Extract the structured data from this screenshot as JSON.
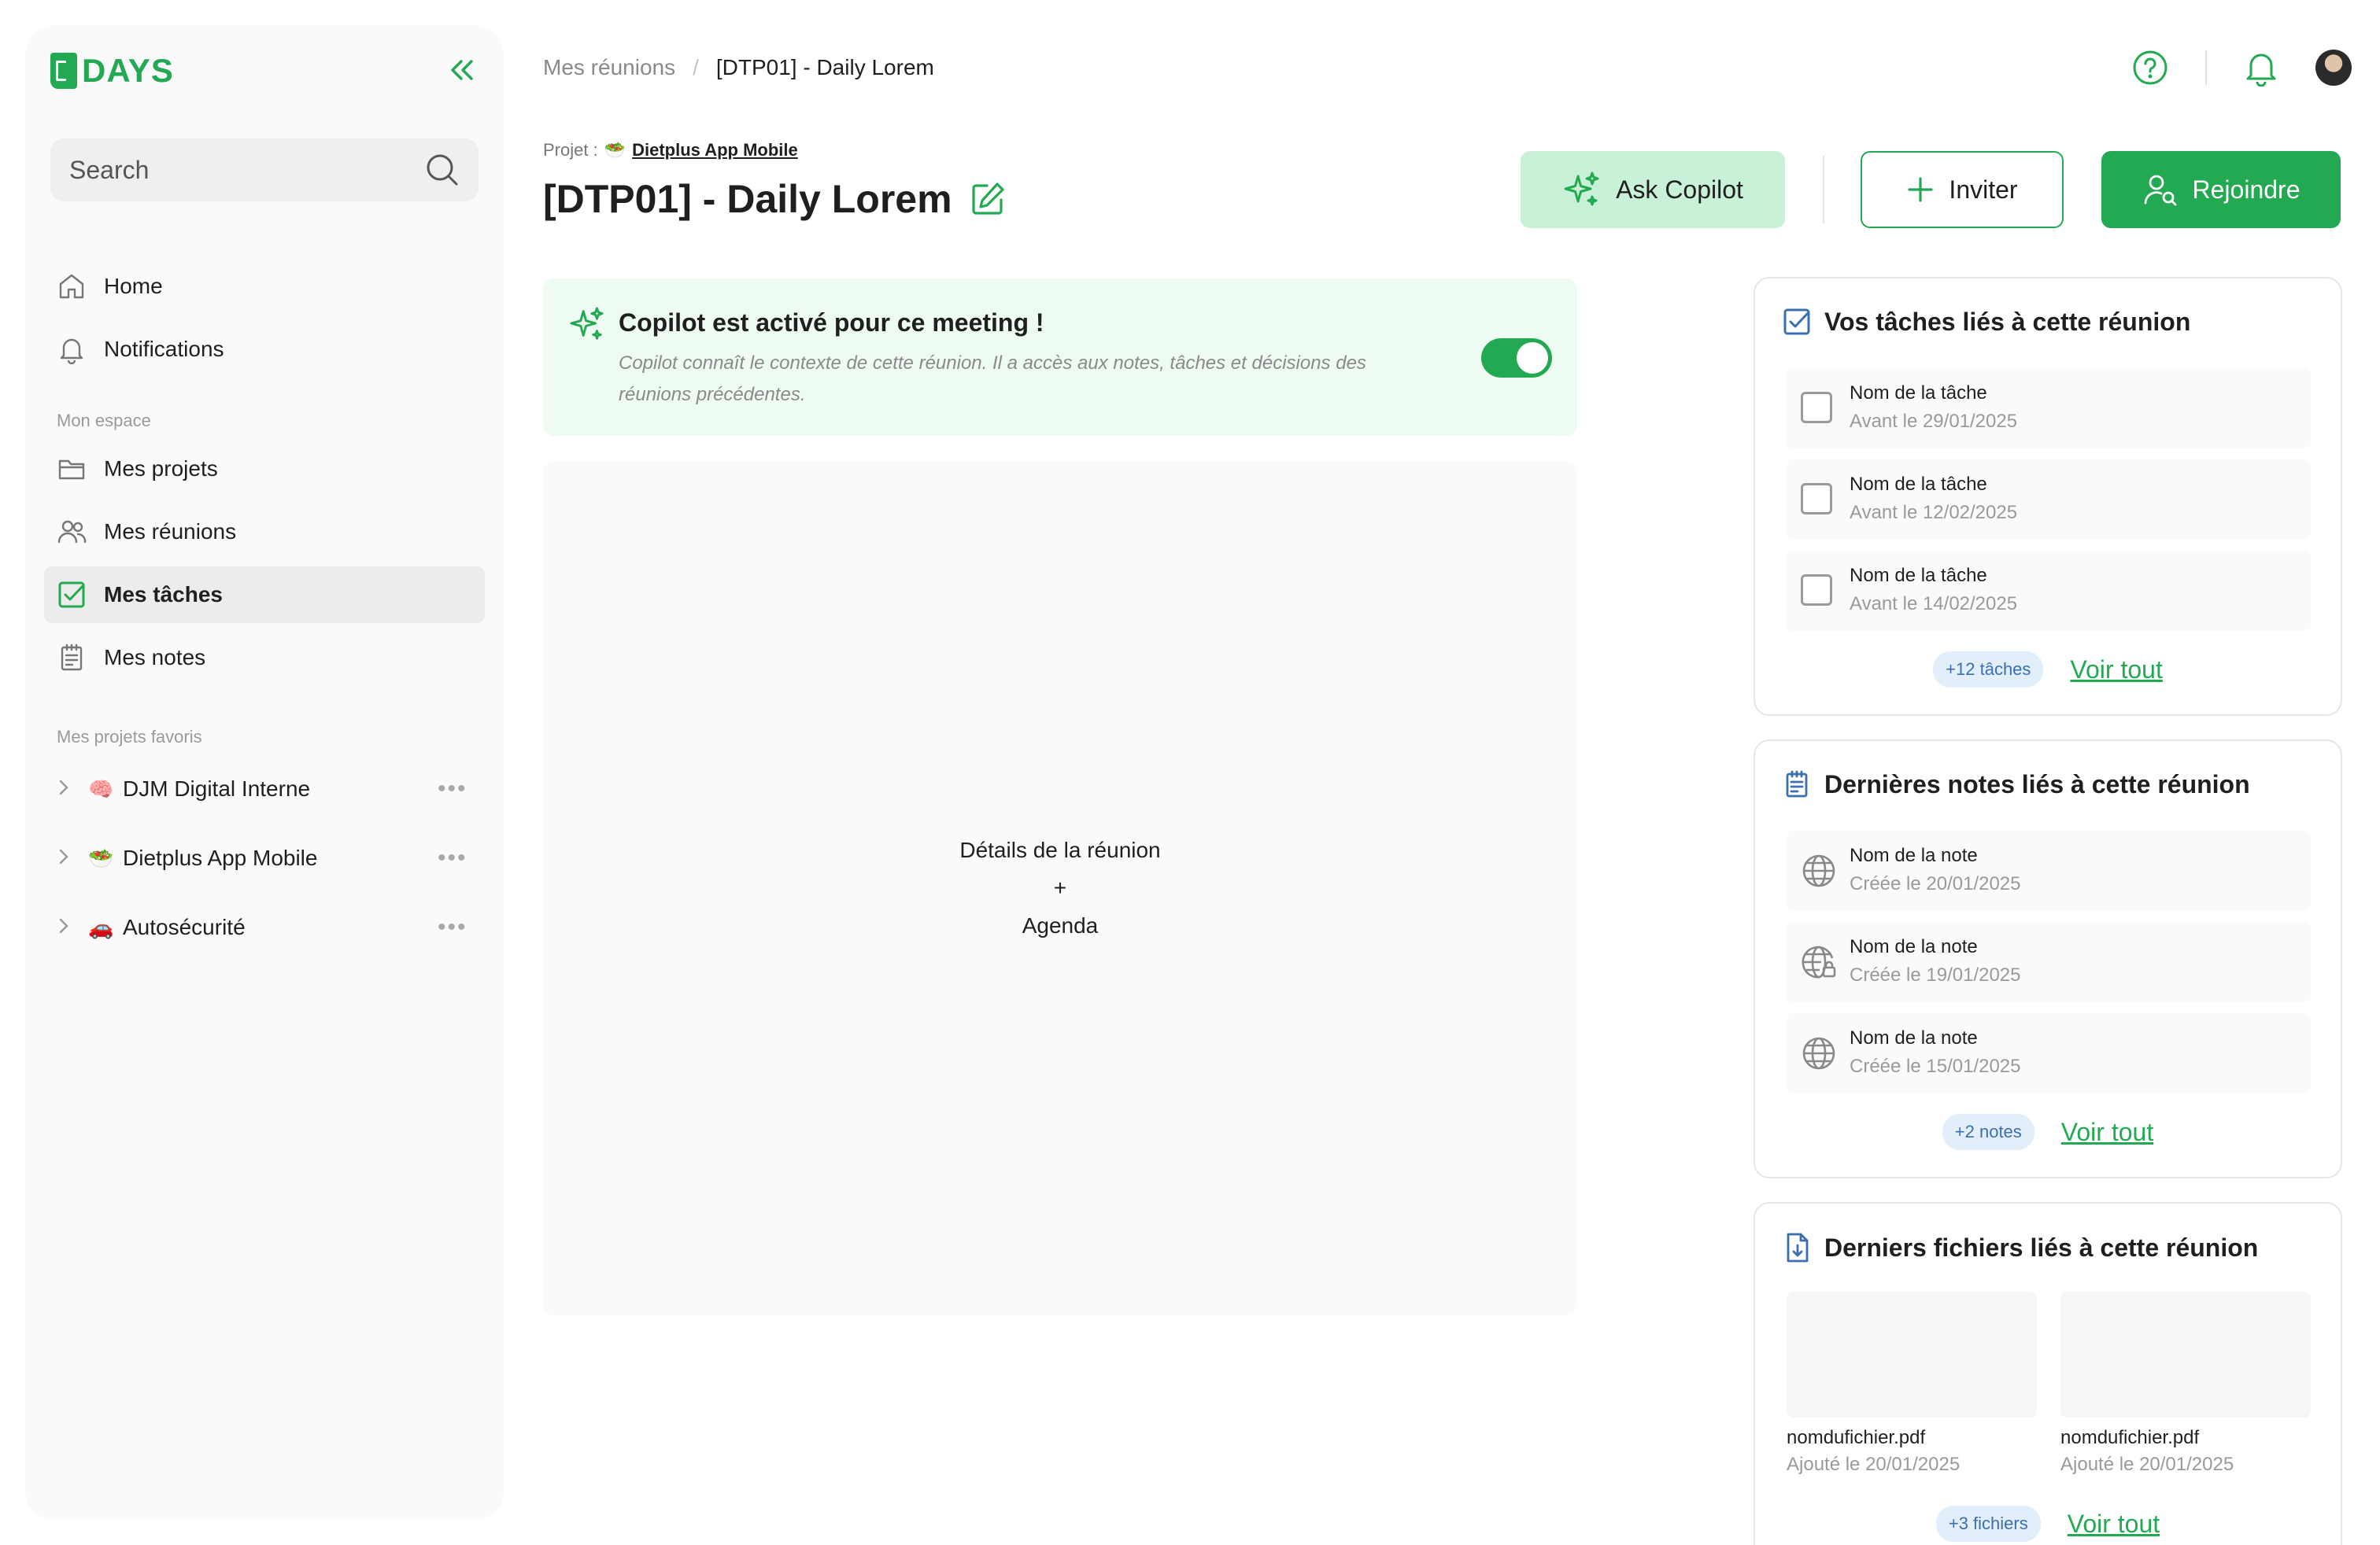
{
  "brand": {
    "name": "DAYS",
    "accent": "#24a953"
  },
  "sidebar": {
    "search_placeholder": "Search",
    "nav": [
      {
        "label": "Home",
        "icon": "home-icon"
      },
      {
        "label": "Notifications",
        "icon": "bell-icon"
      }
    ],
    "section_space": "Mon espace",
    "space_items": [
      {
        "label": "Mes projets",
        "icon": "folder-icon"
      },
      {
        "label": "Mes réunions",
        "icon": "users-icon"
      },
      {
        "label": "Mes tâches",
        "icon": "checkbox-icon",
        "active": true
      },
      {
        "label": "Mes notes",
        "icon": "notes-icon"
      }
    ],
    "section_favorites": "Mes projets favoris",
    "favorites": [
      {
        "emoji": "🧠",
        "label": "DJM Digital Interne"
      },
      {
        "emoji": "🥗",
        "label": "Dietplus App Mobile"
      },
      {
        "emoji": "🚗",
        "label": "Autosécurité"
      }
    ]
  },
  "header": {
    "breadcrumb": [
      "Mes réunions",
      "/",
      "[DTP01] - Daily Lorem"
    ],
    "project_prefix": "Projet :",
    "project_emoji": "🥗",
    "project_name": "Dietplus App Mobile",
    "title": "[DTP01] - Daily Lorem",
    "buttons": {
      "copilot": "Ask Copilot",
      "invite": "Inviter",
      "join": "Rejoindre"
    }
  },
  "copilot_banner": {
    "title": "Copilot est activé pour ce meeting !",
    "description": "Copilot connaît le contexte de cette réunion. Il a accès aux notes, tâches et décisions des réunions précédentes.",
    "enabled": true
  },
  "details": {
    "line1": "Détails de la réunion",
    "line2": "+",
    "line3": "Agenda"
  },
  "tasks_card": {
    "title": "Vos tâches liés à cette réunion",
    "items": [
      {
        "name": "Nom de la tâche",
        "due": "Avant le 29/01/2025"
      },
      {
        "name": "Nom de la tâche",
        "due": "Avant le 12/02/2025"
      },
      {
        "name": "Nom de la tâche",
        "due": "Avant le 14/02/2025"
      }
    ],
    "badge": "+12 tâches",
    "see_all": "Voir tout"
  },
  "notes_card": {
    "title": "Dernières notes liés à cette réunion",
    "items": [
      {
        "name": "Nom de la note",
        "created": "Créée le 20/01/2025",
        "icon": "globe-icon"
      },
      {
        "name": "Nom de la note",
        "created": "Créée le 19/01/2025",
        "icon": "globe-lock-icon"
      },
      {
        "name": "Nom de la note",
        "created": "Créée le 15/01/2025",
        "icon": "globe-icon"
      }
    ],
    "badge": "+2 notes",
    "see_all": "Voir tout"
  },
  "files_card": {
    "title": "Derniers fichiers liés à cette réunion",
    "items": [
      {
        "name": "nomdufichier.pdf",
        "added": "Ajouté le 20/01/2025"
      },
      {
        "name": "nomdufichier.pdf",
        "added": "Ajouté le 20/01/2025"
      }
    ],
    "badge": "+3 fichiers",
    "see_all": "Voir tout"
  }
}
